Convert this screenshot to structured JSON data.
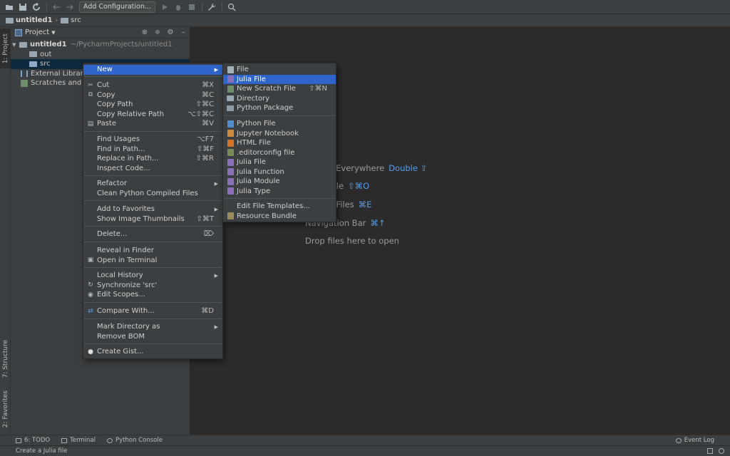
{
  "toolbar": {
    "add_config_label": "Add Configuration..."
  },
  "breadcrumb": [
    "untitled1",
    "src"
  ],
  "left_strip": {
    "project_tab": "1: Project",
    "structure_tab": "7: Structure",
    "favorites_tab": "2: Favorites"
  },
  "project_panel": {
    "title": "Project",
    "tree": [
      {
        "label": "untitled1",
        "path": "~/PycharmProjects/untitled1"
      },
      {
        "label": "out"
      },
      {
        "label": "src"
      },
      {
        "label": "External Libraries"
      },
      {
        "label": "Scratches and Consoles"
      }
    ]
  },
  "editor": {
    "hints": [
      {
        "label": "Search Everywhere",
        "key": "Double ⇧"
      },
      {
        "label": "Go to File",
        "key": "⇧⌘O"
      },
      {
        "label": "Recent Files",
        "key": "⌘E"
      },
      {
        "label": "Navigation Bar",
        "key": "⌘↑"
      },
      {
        "label": "Drop files here to open",
        "key": ""
      }
    ]
  },
  "context_menu": {
    "items": [
      {
        "label": "New",
        "shortcut": ""
      },
      {
        "label": "Cut",
        "shortcut": "⌘X"
      },
      {
        "label": "Copy",
        "shortcut": "⌘C"
      },
      {
        "label": "Copy Path",
        "shortcut": "⇧⌘C"
      },
      {
        "label": "Copy Relative Path",
        "shortcut": "⌥⇧⌘C"
      },
      {
        "label": "Paste",
        "shortcut": "⌘V"
      },
      {
        "label": "Find Usages",
        "shortcut": "⌥F7"
      },
      {
        "label": "Find in Path...",
        "shortcut": "⇧⌘F"
      },
      {
        "label": "Replace in Path...",
        "shortcut": "⇧⌘R"
      },
      {
        "label": "Inspect Code...",
        "shortcut": ""
      },
      {
        "label": "Refactor",
        "shortcut": ""
      },
      {
        "label": "Clean Python Compiled Files",
        "shortcut": ""
      },
      {
        "label": "Add to Favorites",
        "shortcut": ""
      },
      {
        "label": "Show Image Thumbnails",
        "shortcut": "⇧⌘T"
      },
      {
        "label": "Delete...",
        "shortcut": "⌦"
      },
      {
        "label": "Reveal in Finder",
        "shortcut": ""
      },
      {
        "label": "Open in Terminal",
        "shortcut": ""
      },
      {
        "label": "Local History",
        "shortcut": ""
      },
      {
        "label": "Synchronize 'src'",
        "shortcut": ""
      },
      {
        "label": "Edit Scopes...",
        "shortcut": ""
      },
      {
        "label": "Compare With...",
        "shortcut": "⌘D"
      },
      {
        "label": "Mark Directory as",
        "shortcut": ""
      },
      {
        "label": "Remove BOM",
        "shortcut": ""
      },
      {
        "label": "Create Gist...",
        "shortcut": ""
      }
    ]
  },
  "new_submenu": {
    "items": [
      {
        "label": "File",
        "shortcut": ""
      },
      {
        "label": "Julia File",
        "shortcut": ""
      },
      {
        "label": "New Scratch File",
        "shortcut": "⇧⌘N"
      },
      {
        "label": "Directory",
        "shortcut": ""
      },
      {
        "label": "Python Package",
        "shortcut": ""
      },
      {
        "label": "Python File",
        "shortcut": ""
      },
      {
        "label": "Jupyter Notebook",
        "shortcut": ""
      },
      {
        "label": "HTML File",
        "shortcut": ""
      },
      {
        "label": ".editorconfig file",
        "shortcut": ""
      },
      {
        "label": "Julia File",
        "shortcut": ""
      },
      {
        "label": "Julia Function",
        "shortcut": ""
      },
      {
        "label": "Julia Module",
        "shortcut": ""
      },
      {
        "label": "Julia Type",
        "shortcut": ""
      },
      {
        "label": "Edit File Templates...",
        "shortcut": ""
      },
      {
        "label": "Resource Bundle",
        "shortcut": ""
      }
    ]
  },
  "bottom_tools": {
    "todo": "6: TODO",
    "terminal": "Terminal",
    "python_console": "Python Console",
    "event_log": "Event Log"
  },
  "status": {
    "message": "Create a Julia file"
  },
  "colors": {
    "highlight": "#2f65ca",
    "link": "#5b9ee8",
    "panel_bg": "#3c3f41",
    "editor_bg": "#2b2b2b"
  }
}
